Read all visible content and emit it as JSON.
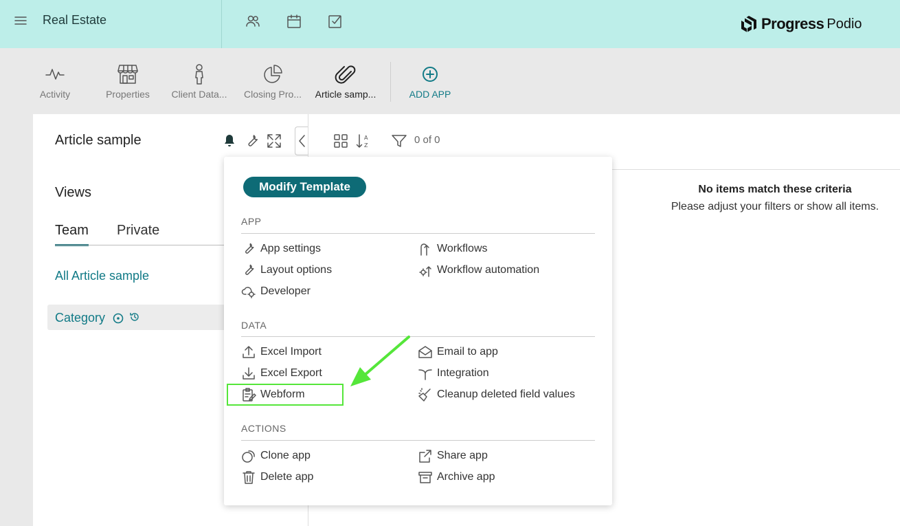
{
  "header": {
    "workspace_title": "Real Estate",
    "logo_word1": "Progress",
    "logo_word2": "Podio",
    "icons": [
      "menu-icon",
      "contacts-icon",
      "calendar-icon",
      "tasks-icon"
    ]
  },
  "apps": [
    {
      "label": "Activity",
      "icon": "activity-icon"
    },
    {
      "label": "Properties",
      "icon": "store-icon"
    },
    {
      "label": "Client Data...",
      "icon": "person-icon"
    },
    {
      "label": "Closing Pro...",
      "icon": "pie-chart-icon"
    },
    {
      "label": "Article samp...",
      "icon": "paperclip-icon"
    },
    {
      "label": "ADD APP",
      "icon": "plus-circle-icon"
    }
  ],
  "sidebar": {
    "app_title": "Article sample",
    "views_title": "Views",
    "tab_team": "Team",
    "tab_private": "Private",
    "all_view": "All Article sample",
    "category": "Category"
  },
  "main": {
    "count": "0 of 0",
    "empty_title": "No items match these criteria",
    "empty_sub": "Please adjust your filters or show all items."
  },
  "menu": {
    "modify_template": "Modify Template",
    "app_heading": "APP",
    "app_left": [
      "App settings",
      "Layout options",
      "Developer"
    ],
    "app_right": [
      "Workflows",
      "Workflow automation"
    ],
    "data_heading": "DATA",
    "data_left": [
      "Excel Import",
      "Excel Export",
      "Webform"
    ],
    "data_right": [
      "Email to app",
      "Integration",
      "Cleanup deleted field values"
    ],
    "actions_heading": "ACTIONS",
    "actions_left": [
      "Clone app",
      "Delete app"
    ],
    "actions_right": [
      "Share app",
      "Archive app"
    ]
  },
  "colors": {
    "topbar": "#bdeee9",
    "accent": "#0e6b76",
    "highlight": "#55e63a"
  }
}
